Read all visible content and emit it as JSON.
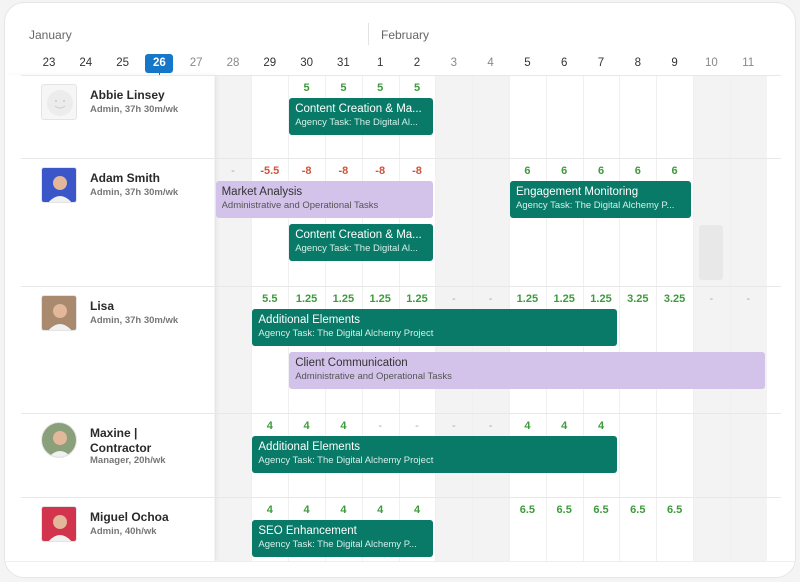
{
  "months": [
    {
      "label": "January"
    },
    {
      "label": "February"
    }
  ],
  "dates": [
    {
      "label": "23",
      "weekend": false
    },
    {
      "label": "24",
      "weekend": false
    },
    {
      "label": "25",
      "weekend": false
    },
    {
      "label": "26",
      "weekend": false,
      "today": true
    },
    {
      "label": "27",
      "weekend": true
    },
    {
      "label": "28",
      "weekend": true
    },
    {
      "label": "29",
      "weekend": false
    },
    {
      "label": "30",
      "weekend": false
    },
    {
      "label": "31",
      "weekend": false
    },
    {
      "label": "1",
      "weekend": false
    },
    {
      "label": "2",
      "weekend": false
    },
    {
      "label": "3",
      "weekend": true
    },
    {
      "label": "4",
      "weekend": true
    },
    {
      "label": "5",
      "weekend": false
    },
    {
      "label": "6",
      "weekend": false
    },
    {
      "label": "7",
      "weekend": false
    },
    {
      "label": "8",
      "weekend": false
    },
    {
      "label": "9",
      "weekend": false
    },
    {
      "label": "10",
      "weekend": true
    },
    {
      "label": "11",
      "weekend": true
    }
  ],
  "colors": {
    "agency": "#087a67",
    "admin": "#d3c3ea",
    "today": "#1677c9",
    "positive": "#3f9a3c",
    "negative": "#d0533a",
    "neutral": "#aaaaaa"
  },
  "people": [
    {
      "name": "Abbie Linsey",
      "role": "Admin, 37h 30m/wk",
      "avatar": "placeholder-face",
      "hours": [
        "",
        "",
        "5",
        "5",
        "5",
        "5",
        "",
        "",
        "",
        "",
        "",
        "",
        "",
        ""
      ],
      "bars": [
        {
          "title": "Content Creation & Ma...",
          "subtitle": "Agency Task: The Digital Al...",
          "type": "agency",
          "start": "30",
          "end": "2",
          "lane": 0
        }
      ]
    },
    {
      "name": "Adam Smith",
      "role": "Admin, 37h 30m/wk",
      "avatar": "photo",
      "hours": [
        "-",
        "-5.5",
        "-8",
        "-8",
        "-8",
        "-8",
        "",
        "",
        "6",
        "6",
        "6",
        "6",
        "6",
        "",
        ""
      ],
      "bars": [
        {
          "title": "Market Analysis",
          "subtitle": "Administrative and Operational Tasks",
          "type": "admin",
          "start": "28",
          "end": "2",
          "lane": 0
        },
        {
          "title": "Engagement Monitoring",
          "subtitle": "Agency Task: The Digital Alchemy P...",
          "type": "agency",
          "start": "5",
          "end": "9",
          "lane": 0
        },
        {
          "title": "Content Creation & Ma...",
          "subtitle": "Agency Task: The Digital Al...",
          "type": "agency",
          "start": "30",
          "end": "2",
          "lane": 1
        }
      ],
      "placeholder": "10"
    },
    {
      "name": "Lisa",
      "role": "Admin, 37h 30m/wk",
      "avatar": "photo",
      "hours": [
        "",
        "5.5",
        "1.25",
        "1.25",
        "1.25",
        "1.25",
        "-",
        "-",
        "1.25",
        "1.25",
        "1.25",
        "3.25",
        "3.25",
        "-",
        "-"
      ],
      "bars": [
        {
          "title": "Additional Elements",
          "subtitle": "Agency Task: The Digital Alchemy Project",
          "type": "agency",
          "start": "29",
          "end": "7",
          "lane": 0
        },
        {
          "title": "Client Communication",
          "subtitle": "Administrative and Operational Tasks",
          "type": "admin",
          "start": "30",
          "end": "11",
          "lane": 1
        }
      ]
    },
    {
      "name": "Maxine | Contractor",
      "role": "Manager, 20h/wk",
      "avatar": "photo",
      "hours": [
        "",
        "4",
        "4",
        "4",
        "-",
        "-",
        "-",
        "-",
        "4",
        "4",
        "4",
        "",
        "",
        ""
      ],
      "bars": [
        {
          "title": "Additional Elements",
          "subtitle": "Agency Task: The Digital Alchemy Project",
          "type": "agency",
          "start": "29",
          "end": "7",
          "lane": 0
        }
      ]
    },
    {
      "name": "Miguel Ochoa",
      "role": "Admin, 40h/wk",
      "avatar": "photo",
      "hours": [
        "",
        "4",
        "4",
        "4",
        "4",
        "4",
        "",
        "",
        "6.5",
        "6.5",
        "6.5",
        "6.5",
        "6.5",
        "",
        ""
      ],
      "bars": [
        {
          "title": "SEO Enhancement",
          "subtitle": "Agency Task: The Digital Alchemy P...",
          "type": "agency",
          "start": "29",
          "end": "2",
          "lane": 0
        }
      ]
    }
  ]
}
